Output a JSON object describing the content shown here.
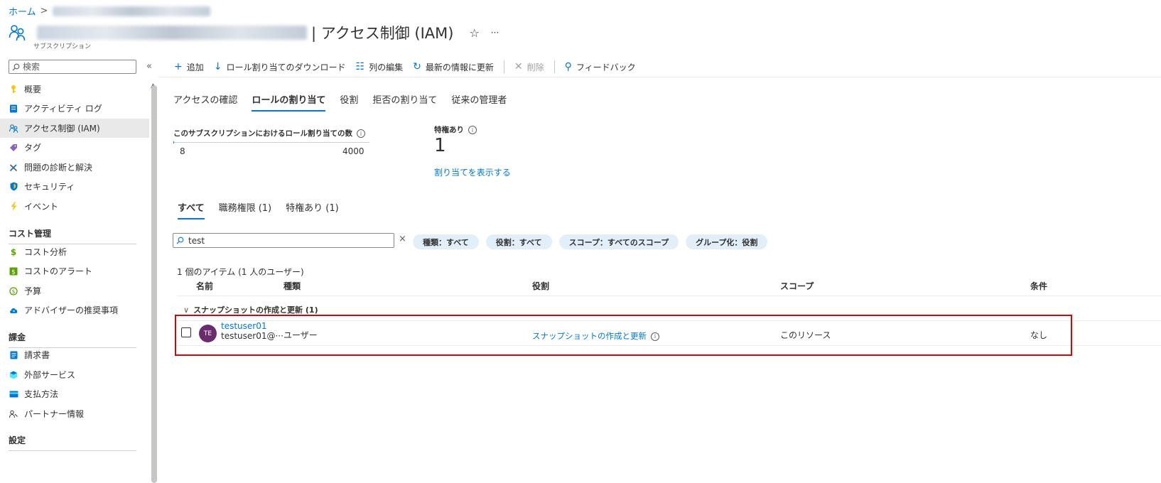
{
  "breadcrumb": {
    "home": "ホーム",
    "separator": ">"
  },
  "header": {
    "title": "| アクセス制御 (IAM)",
    "subtitle": "サブスクリプション",
    "icons": [
      "people-icon",
      "star-icon",
      "more-icon"
    ],
    "star_glyph": "☆",
    "more_glyph": "···"
  },
  "sidebar": {
    "search_placeholder": "検索",
    "collapse_glyph": "«",
    "items": [
      {
        "label": "概要",
        "icon": "key-icon"
      },
      {
        "label": "アクティビティ ログ",
        "icon": "log-icon"
      },
      {
        "label": "アクセス制御 (IAM)",
        "icon": "people-icon",
        "active": true
      },
      {
        "label": "タグ",
        "icon": "tag-icon"
      },
      {
        "label": "問題の診断と解決",
        "icon": "wrench-icon"
      },
      {
        "label": "セキュリティ",
        "icon": "shield-icon"
      },
      {
        "label": "イベント",
        "icon": "lightning-icon"
      }
    ],
    "section_cost": "コスト管理",
    "cost_items": [
      {
        "label": "コスト分析",
        "icon": "cost-analysis-icon"
      },
      {
        "label": "コストのアラート",
        "icon": "cost-alert-icon"
      },
      {
        "label": "予算",
        "icon": "budget-icon"
      },
      {
        "label": "アドバイザーの推奨事項",
        "icon": "advisor-icon"
      }
    ],
    "section_billing": "課金",
    "billing_items": [
      {
        "label": "請求書",
        "icon": "invoice-icon"
      },
      {
        "label": "外部サービス",
        "icon": "external-service-icon"
      },
      {
        "label": "支払方法",
        "icon": "payment-icon"
      },
      {
        "label": "パートナー情報",
        "icon": "partner-icon"
      }
    ],
    "section_settings": "設定"
  },
  "toolbar": {
    "add": "追加",
    "download": "ロール割り当てのダウンロード",
    "edit_columns": "列の編集",
    "refresh": "最新の情報に更新",
    "delete": "削除",
    "feedback": "フィードバック"
  },
  "tabs": [
    "アクセスの確認",
    "ロールの割り当て",
    "役割",
    "拒否の割り当て",
    "従来の管理者"
  ],
  "active_tab": "ロールの割り当て",
  "stats": {
    "assignment_label": "このサブスクリプションにおけるロール割り当ての数",
    "current": "8",
    "max": "4000",
    "usage_fraction": 0.002,
    "privileged_label": "特権あり",
    "privileged_count": "1",
    "show_assignments_link": "割り当てを表示する"
  },
  "subtabs": [
    "すべて",
    "職務権限 (1)",
    "特権あり (1)"
  ],
  "filter": {
    "value": "test",
    "clear_glyph": "×",
    "pills": [
      "種類：すべて",
      "役割：すべて",
      "スコープ：すべてのスコープ",
      "グループ化：役割"
    ]
  },
  "grid": {
    "item_count": "1 個のアイテム (1 人のユーザー)",
    "columns": {
      "name": "名前",
      "type": "種類",
      "role": "役割",
      "scope": "スコープ",
      "condition": "条件"
    },
    "group_label": "スナップショットの作成と更新 (1)",
    "group_chevron": "∨",
    "rows": [
      {
        "initials": "TE",
        "name": "testuser01",
        "email": "testuser01@···",
        "type": "ユーザー",
        "role": "スナップショットの作成と更新",
        "scope": "このリソース",
        "condition": "なし",
        "avatar_color": "#6b2c6e"
      }
    ]
  },
  "colors": {
    "accent": "#0078d4",
    "highlight": "#e00000",
    "pill_bg": "#e1effa"
  }
}
